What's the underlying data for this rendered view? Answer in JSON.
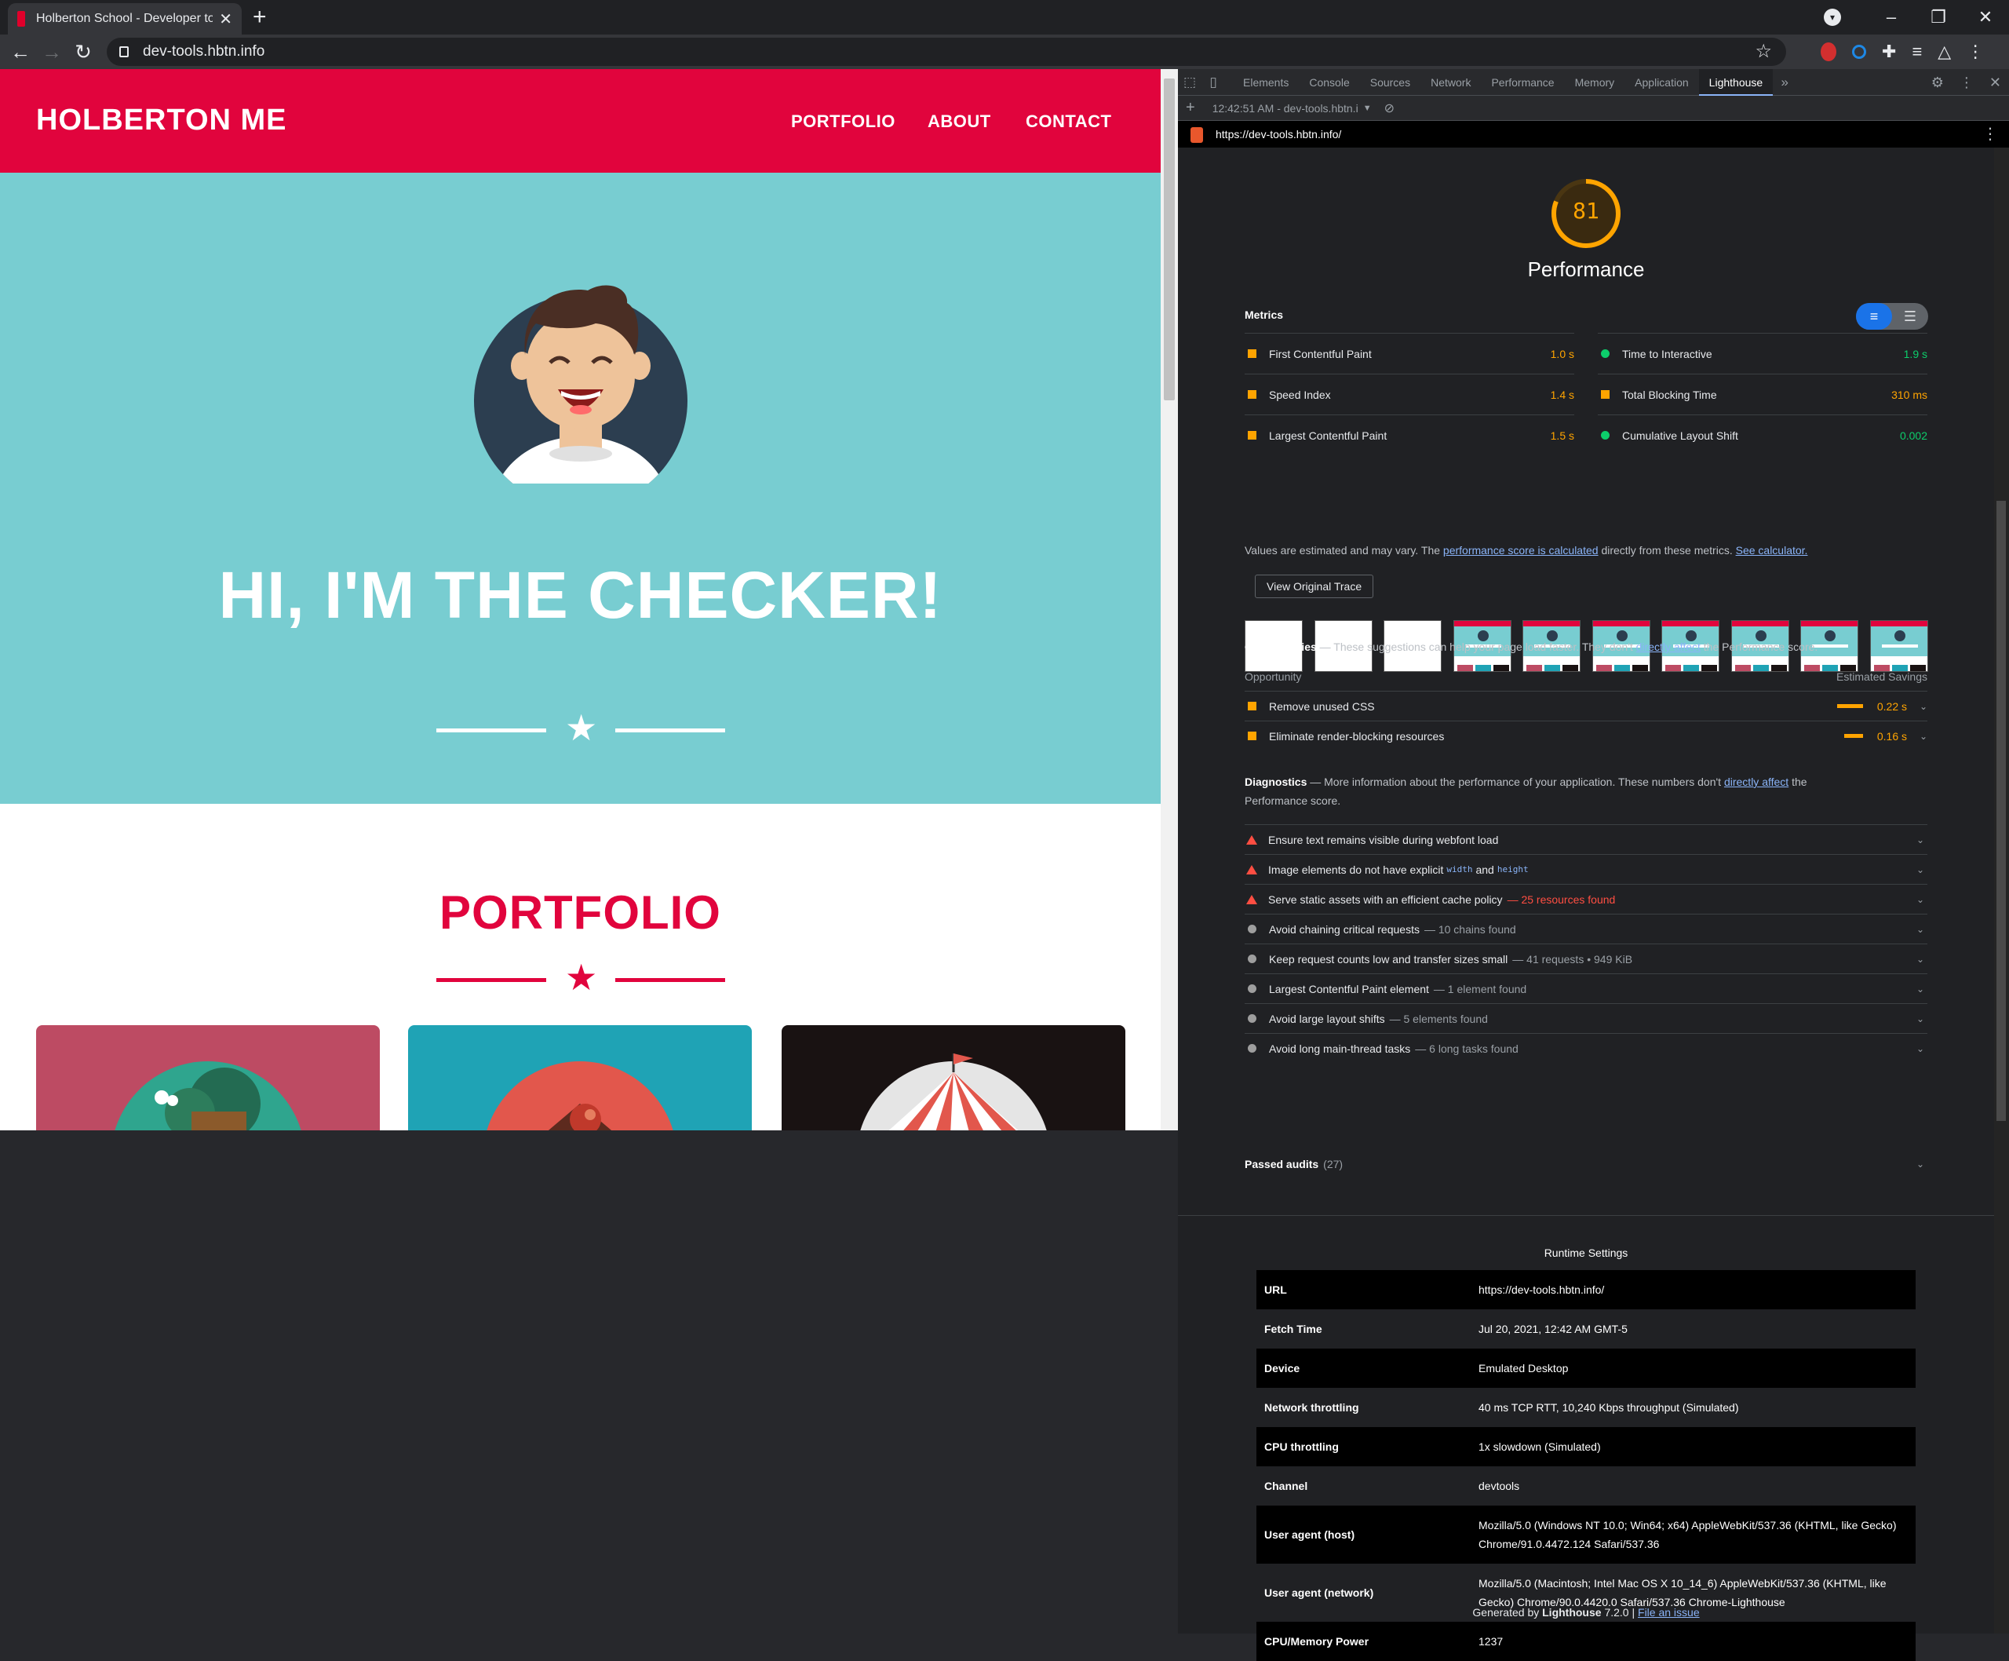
{
  "browser": {
    "tab_title": "Holberton School - Developer to",
    "url": "dev-tools.hbtn.info"
  },
  "site": {
    "brand": "HOLBERTON ME",
    "nav": [
      "PORTFOLIO",
      "ABOUT",
      "CONTACT"
    ],
    "hero_title": "HI, I'M THE CHECKER!",
    "portfolio_title": "PORTFOLIO",
    "colors": {
      "primary": "#e1043d",
      "hero_bg": "#78cdd1"
    }
  },
  "devtools": {
    "tabs": [
      "Elements",
      "Console",
      "Sources",
      "Network",
      "Performance",
      "Memory",
      "Application",
      "Lighthouse"
    ],
    "active_tab": "Lighthouse",
    "report_selector": "12:42:51 AM - dev-tools.hbtn.i",
    "report_url": "https://dev-tools.hbtn.info/"
  },
  "lighthouse": {
    "score": "81",
    "score_fraction": 0.81,
    "category": "Performance",
    "metrics_label": "Metrics",
    "metrics": [
      {
        "name": "First Contentful Paint",
        "value": "1.0 s",
        "status": "average"
      },
      {
        "name": "Time to Interactive",
        "value": "1.9 s",
        "status": "pass"
      },
      {
        "name": "Speed Index",
        "value": "1.4 s",
        "status": "average"
      },
      {
        "name": "Total Blocking Time",
        "value": "310 ms",
        "status": "average"
      },
      {
        "name": "Largest Contentful Paint",
        "value": "1.5 s",
        "status": "average"
      },
      {
        "name": "Cumulative Layout Shift",
        "value": "0.002",
        "status": "pass"
      }
    ],
    "note": {
      "pre": "Values are estimated and may vary. The ",
      "link1": "performance score is calculated",
      "mid": " directly from these metrics. ",
      "link2": "See calculator."
    },
    "trace_button": "View Original Trace",
    "opportunities": {
      "title": "Opportunities",
      "desc_pre": " — These suggestions can help your page load faster. They don't ",
      "desc_link": "directly affect",
      "desc_post": " the Performance score.",
      "col_left": "Opportunity",
      "col_right": "Estimated Savings",
      "items": [
        {
          "name": "Remove unused CSS",
          "value": "0.22 s",
          "savings_s": 0.22
        },
        {
          "name": "Eliminate render-blocking resources",
          "value": "0.16 s",
          "savings_s": 0.16
        }
      ]
    },
    "diagnostics": {
      "title": "Diagnostics",
      "desc_pre": " — More information about the performance of your application. These numbers don't ",
      "desc_link": "directly affect",
      "desc_post1": " the",
      "desc_post2": "Performance score.",
      "items": [
        {
          "name": "Ensure text remains visible during webfont load",
          "sub": "",
          "level": "fail"
        },
        {
          "name": "Image elements do not have explicit",
          "code1": "width",
          "and": "and",
          "code2": "height",
          "level": "fail"
        },
        {
          "name": "Serve static assets with an efficient cache policy",
          "sub": "— 25 resources found",
          "level": "fail"
        },
        {
          "name": "Avoid chaining critical requests",
          "sub": "— 10 chains found",
          "level": "info"
        },
        {
          "name": "Keep request counts low and transfer sizes small",
          "sub": "— 41 requests • 949 KiB",
          "level": "info"
        },
        {
          "name": "Largest Contentful Paint element",
          "sub": "— 1 element found",
          "level": "info"
        },
        {
          "name": "Avoid large layout shifts",
          "sub": "— 5 elements found",
          "level": "info"
        },
        {
          "name": "Avoid long main-thread tasks",
          "sub": "— 6 long tasks found",
          "level": "info"
        }
      ]
    },
    "passed": {
      "label": "Passed audits",
      "count": "(27)"
    },
    "runtime": {
      "title": "Runtime Settings",
      "rows": [
        {
          "k": "URL",
          "v": "https://dev-tools.hbtn.info/"
        },
        {
          "k": "Fetch Time",
          "v": "Jul 20, 2021, 12:42 AM GMT-5"
        },
        {
          "k": "Device",
          "v": "Emulated Desktop"
        },
        {
          "k": "Network throttling",
          "v": "40 ms TCP RTT, 10,240 Kbps throughput (Simulated)"
        },
        {
          "k": "CPU throttling",
          "v": "1x slowdown (Simulated)"
        },
        {
          "k": "Channel",
          "v": "devtools"
        },
        {
          "k": "User agent (host)",
          "v": "Mozilla/5.0 (Windows NT 10.0; Win64; x64) AppleWebKit/537.36 (KHTML, like Gecko) Chrome/91.0.4472.124 Safari/537.36"
        },
        {
          "k": "User agent (network)",
          "v": "Mozilla/5.0 (Macintosh; Intel Mac OS X 10_14_6) AppleWebKit/537.36 (KHTML, like Gecko) Chrome/90.0.4420.0 Safari/537.36 Chrome-Lighthouse"
        },
        {
          "k": "CPU/Memory Power",
          "v": "1237"
        }
      ]
    },
    "generated": {
      "pre": "Generated by ",
      "brand": "Lighthouse",
      "version": " 7.2.0 | ",
      "link": "File an issue"
    },
    "colors": {
      "average": "#ffa400",
      "pass": "#0cce6b",
      "fail": "#ff4e42"
    }
  }
}
